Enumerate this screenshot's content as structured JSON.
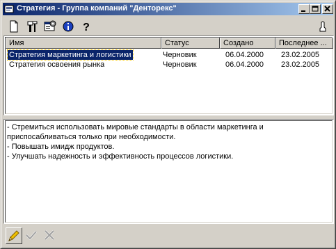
{
  "window": {
    "title": "Стратегия - Группа компаний \"Денторекс\""
  },
  "toolbar": {
    "items": [
      {
        "icon": "new-document-icon"
      },
      {
        "icon": "tools-icon"
      },
      {
        "icon": "properties-icon"
      },
      {
        "icon": "info-icon"
      },
      {
        "icon": "help-icon",
        "label": "?"
      },
      {
        "icon": "pointer-icon"
      }
    ]
  },
  "list": {
    "columns": [
      "Имя",
      "Статус",
      "Создано",
      "Последнее ..."
    ],
    "rows": [
      {
        "name": "Стратегия маркетинга и логистики",
        "status": "Черновик",
        "created": "06.04.2000",
        "modified": "23.02.2005",
        "selected": true
      },
      {
        "name": "Стратегия освоения рынка",
        "status": "Черновик",
        "created": "06.04.2000",
        "modified": "23.02.2005",
        "selected": false
      }
    ]
  },
  "description": {
    "lines": [
      "- Стремиться использовать мировые стандарты в области маркетинга и",
      "приспосабливаться только при необходимости.",
      "- Повышать имидж продуктов.",
      "- Улучшать надежность и эффективность процессов логистики."
    ]
  },
  "bottom_toolbar": {
    "edit": "pencil-icon",
    "apply": "checkmark-icon",
    "cancel": "x-icon"
  },
  "colors": {
    "titlebar_start": "#0a246a",
    "titlebar_end": "#a6caf0",
    "selection": "#0a246a",
    "face": "#d4d0c8"
  }
}
